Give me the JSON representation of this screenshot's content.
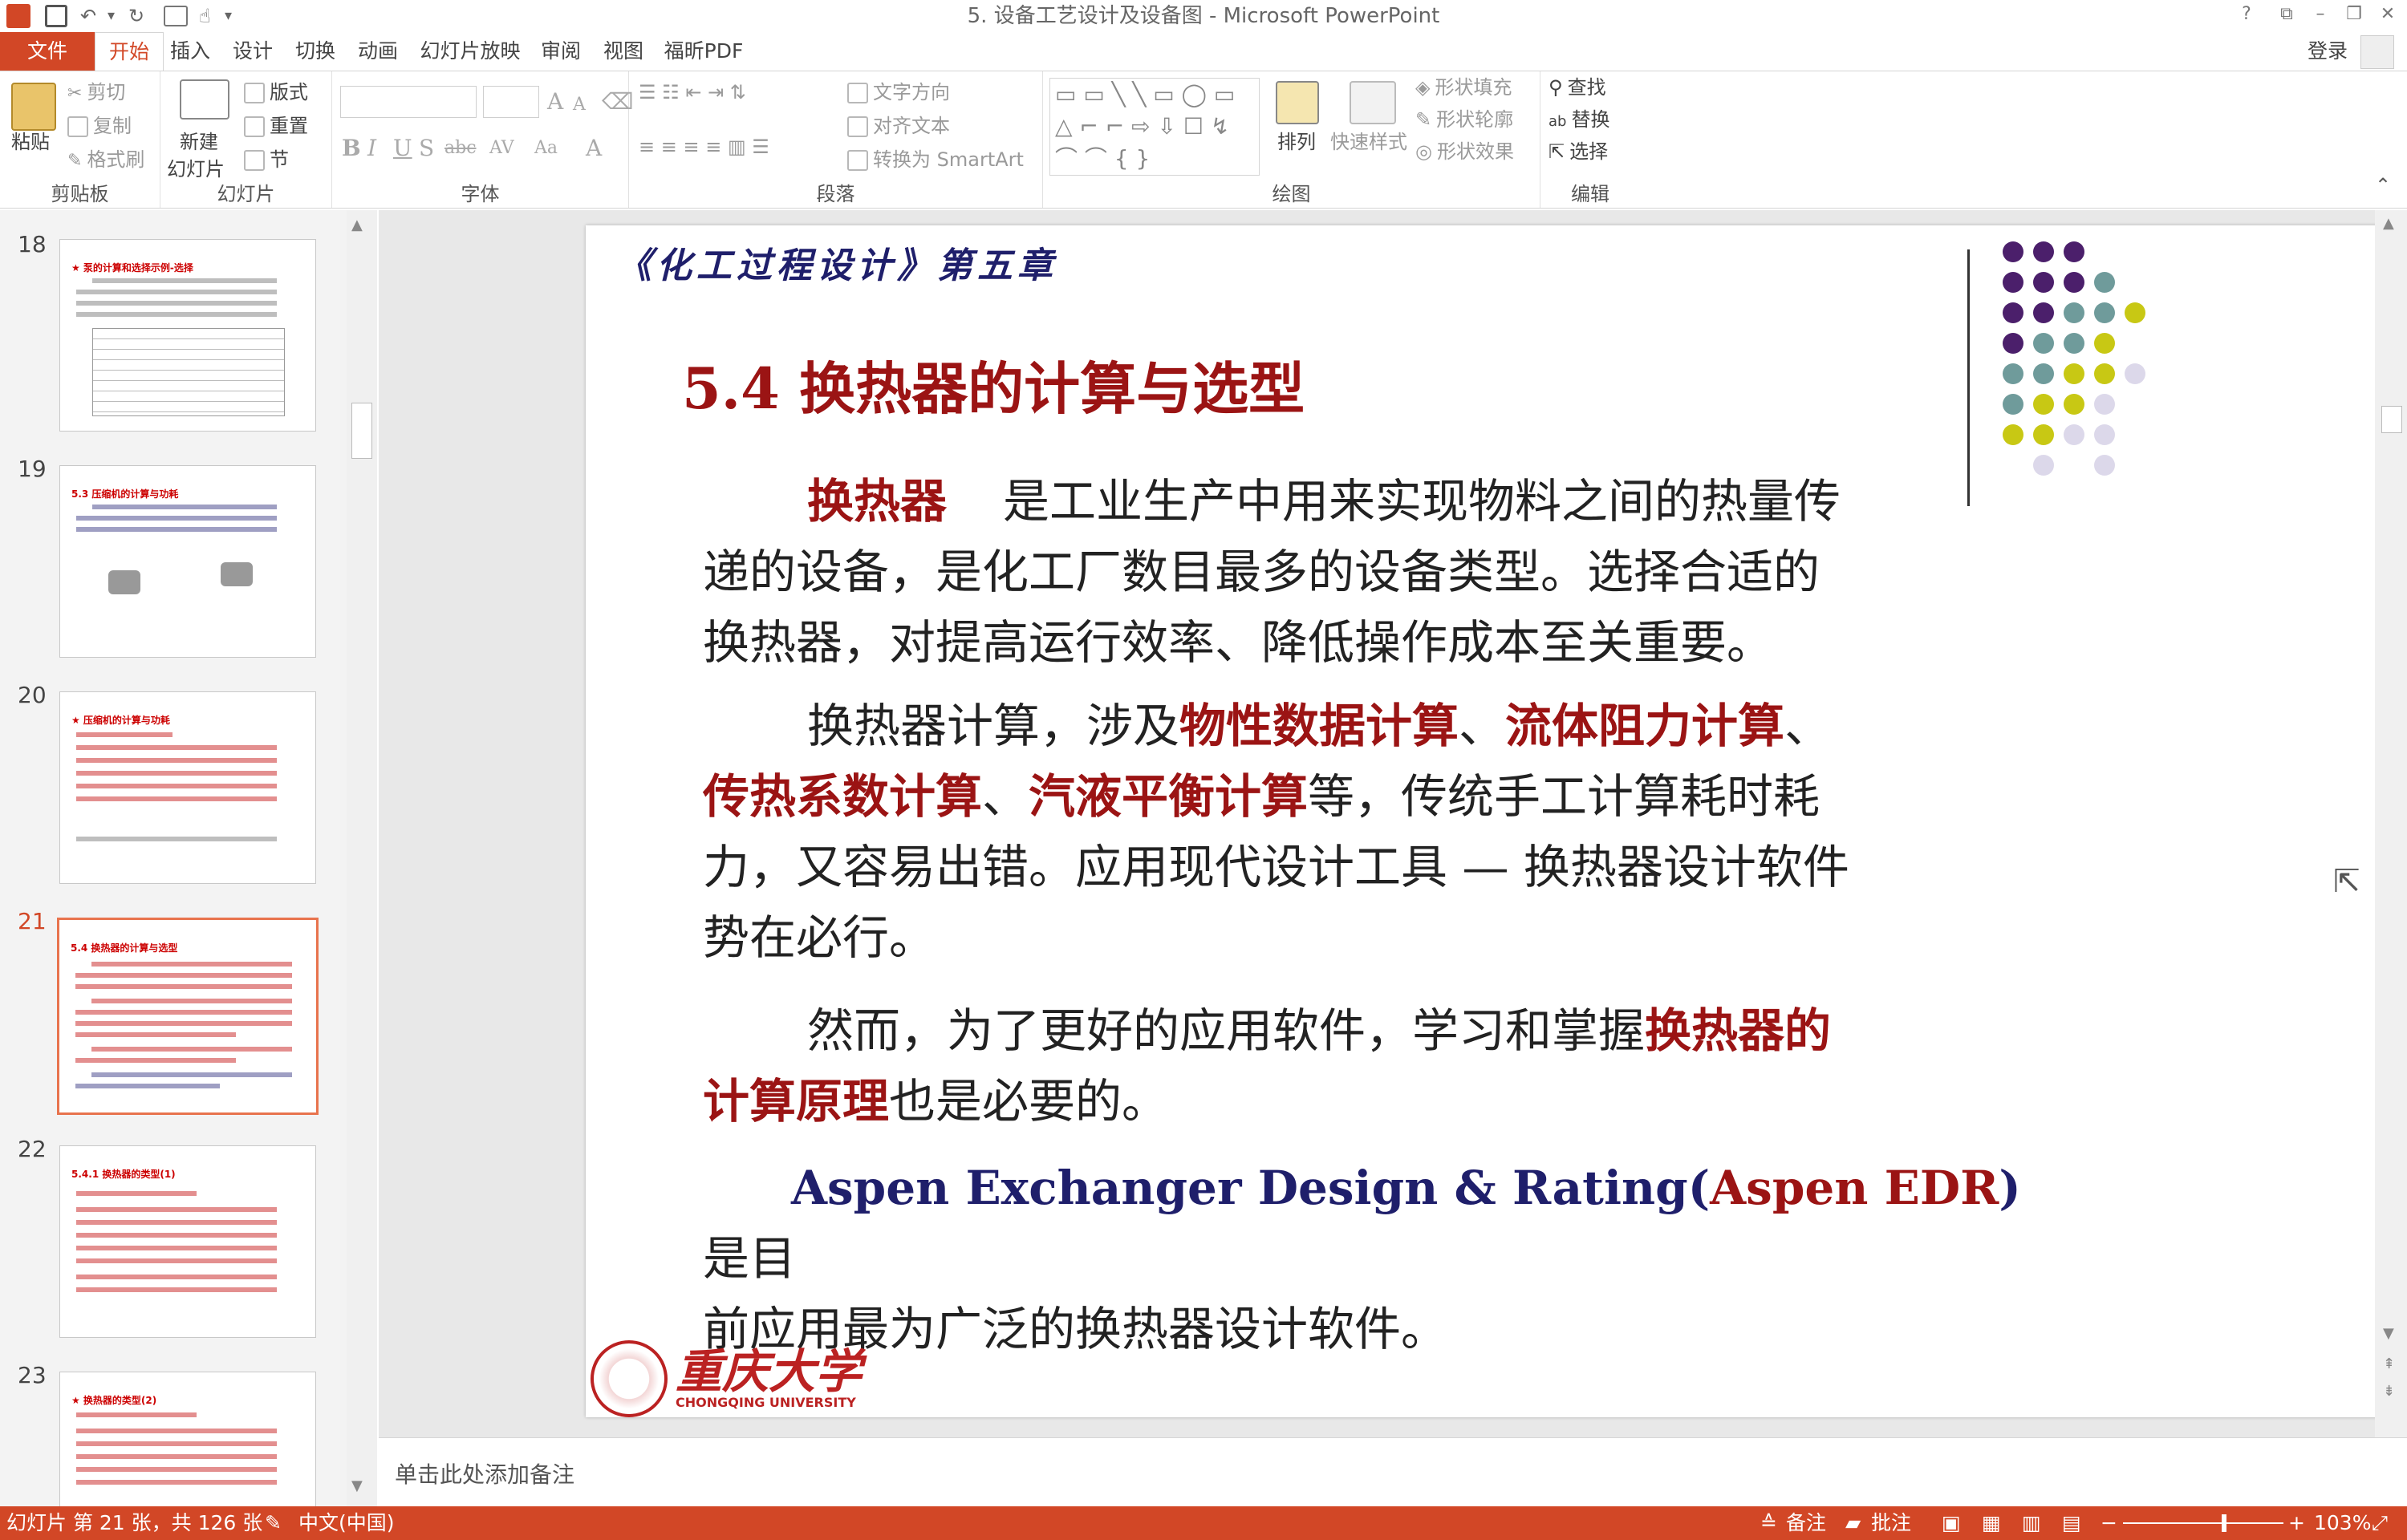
{
  "titlebar": {
    "title": "5. 设备工艺设计及设备图 - Microsoft PowerPoint",
    "help": "?"
  },
  "tabs": [
    {
      "label": "文件"
    },
    {
      "label": "开始"
    },
    {
      "label": "插入"
    },
    {
      "label": "设计"
    },
    {
      "label": "切换"
    },
    {
      "label": "动画"
    },
    {
      "label": "幻灯片放映"
    },
    {
      "label": "审阅"
    },
    {
      "label": "视图"
    },
    {
      "label": "福昕PDF"
    }
  ],
  "account": {
    "login": "登录"
  },
  "ribbon": {
    "clipboard": {
      "label": "剪贴板",
      "paste": "粘贴",
      "cut": "剪切",
      "copy": "复制",
      "format_painter": "格式刷"
    },
    "slides": {
      "label": "幻灯片",
      "new_slide_1": "新建",
      "new_slide_2": "幻灯片",
      "layout": "版式",
      "reset": "重置",
      "section": "节"
    },
    "font": {
      "label": "字体"
    },
    "paragraph": {
      "label": "段落",
      "text_direction": "文字方向",
      "align_text": "对齐文本",
      "convert_smartart": "转换为 SmartArt"
    },
    "drawing": {
      "label": "绘图",
      "arrange": "排列",
      "quick_styles": "快速样式",
      "shape_fill": "形状填充",
      "shape_outline": "形状轮廓",
      "shape_effects": "形状效果"
    },
    "editing": {
      "label": "编辑",
      "find": "查找",
      "replace": "替换",
      "select": "选择"
    }
  },
  "thumbnails": [
    {
      "num": "18",
      "title": "★ 泵的计算和选择示例-选择"
    },
    {
      "num": "19",
      "title": "5.3 压缩机的计算与功耗"
    },
    {
      "num": "20",
      "title": "★ 压缩机的计算与功耗"
    },
    {
      "num": "21",
      "title": "5.4 换热器的计算与选型"
    },
    {
      "num": "22",
      "title": "5.4.1 换热器的类型(1)"
    },
    {
      "num": "23",
      "title": "★ 换热器的类型(2)"
    }
  ],
  "slide": {
    "chapter": "《化工过程设计》第五章",
    "heading": "5.4 换热器的计算与选型",
    "p1": {
      "term": "换热器",
      "line1": "是工业生产中用来实现物料之间的热量传",
      "line2": "递的设备，是化工厂数目最多的设备类型。选择合适的",
      "line3": "换热器，对提高运行效率、降低操作成本至关重要。"
    },
    "p2": {
      "pre": "换热器计算，涉及",
      "t1": "物性数据计算",
      "sep1": "、",
      "t2": "流体阻力计算",
      "sep2": "、",
      "t3": "传热系数计算",
      "sep3": "、",
      "t4": "汽液平衡计算",
      "post": "等，传统手工计算耗时耗",
      "line3": "力，又容易出错。应用现代设计工具 — 换热器设计软件",
      "line4": "势在必行。"
    },
    "p3": {
      "pre": "然而，为了更好的应用软件，学习和掌握",
      "t1": "换热器的",
      "t2": "计算原理",
      "post": "也是必要的。"
    },
    "p4": {
      "en1": "Aspen Exchanger Design & Rating(",
      "en2": "Aspen EDR",
      "en3": ")",
      "cn1": "是目",
      "line2": "前应用最为广泛的换热器设计软件。"
    },
    "logo_cn": "重庆大学",
    "logo_en": "CHONGQING UNIVERSITY"
  },
  "notes": {
    "placeholder": "单击此处添加备注"
  },
  "status": {
    "slide_info": "幻灯片 第 21 张，共 126 张",
    "language": "中文(中国)",
    "notes": "备注",
    "comments": "批注",
    "zoom": "103%"
  },
  "colors": {
    "accent": "#d24726",
    "heading_red": "#9b1414",
    "navy": "#1f1f6b",
    "dot_purple": "#4b1f6b",
    "dot_teal": "#6f9b9b",
    "dot_yellow": "#c8c814",
    "dot_lilac": "#dcd8ea"
  }
}
